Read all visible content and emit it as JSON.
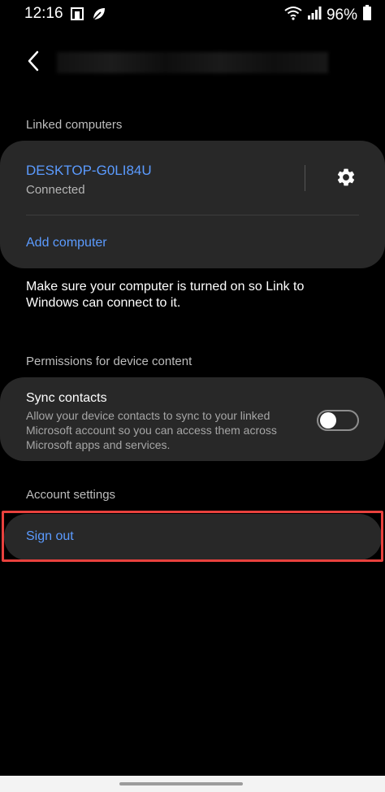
{
  "status_bar": {
    "time": "12:16",
    "battery_pct": "96%",
    "icons_left": [
      "notification-icon",
      "leaf-icon"
    ],
    "icons_right": [
      "wifi-icon",
      "signal-icon",
      "battery-icon"
    ]
  },
  "header": {
    "back_icon": "back-arrow-icon"
  },
  "linked": {
    "section_label": "Linked computers",
    "pc_name": "DESKTOP-G0LI84U",
    "pc_status": "Connected",
    "settings_icon": "gear-icon",
    "add_computer": "Add computer"
  },
  "info_text": "Make sure your computer is turned on so Link to Windows can connect to it.",
  "permissions": {
    "section_label": "Permissions for device content",
    "sync_title": "Sync contacts",
    "sync_desc": "Allow your device contacts to sync to your linked Microsoft account so you can access them across Microsoft apps and services.",
    "sync_on": false
  },
  "account": {
    "section_label": "Account settings",
    "sign_out": "Sign out"
  },
  "colors": {
    "accent": "#5b9bff",
    "highlight": "#e8413d",
    "card": "#282828"
  }
}
